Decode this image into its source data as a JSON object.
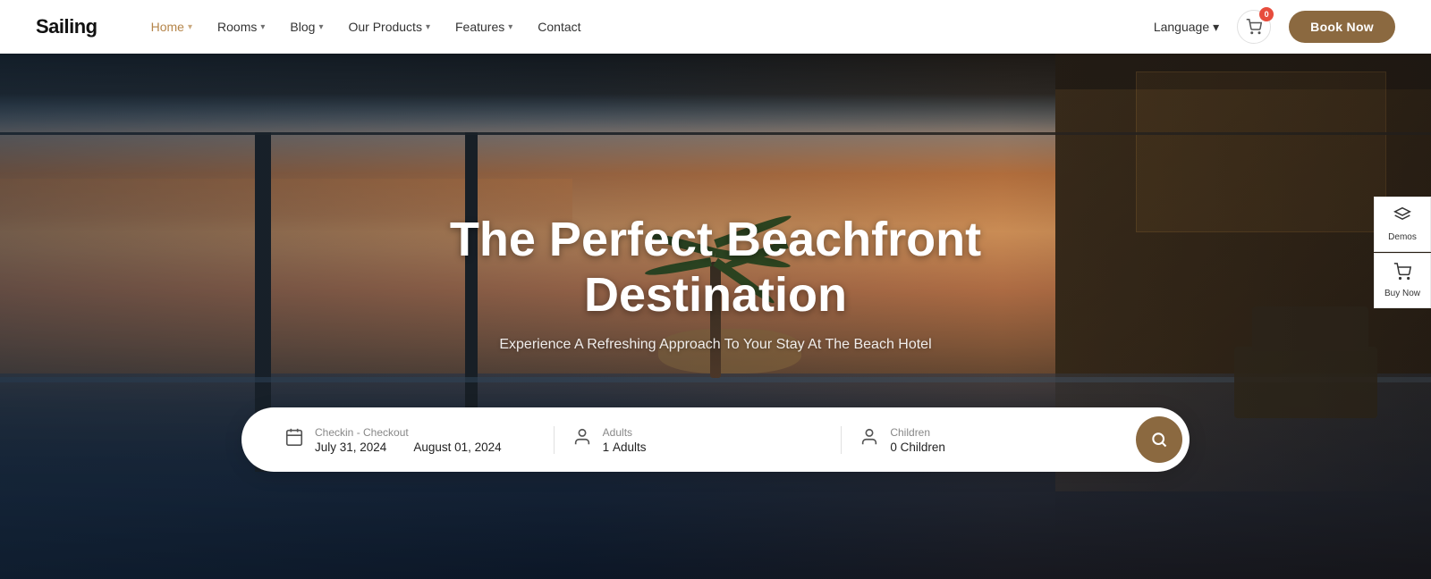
{
  "brand": {
    "logo": "Sailing"
  },
  "navbar": {
    "links": [
      {
        "label": "Home",
        "active": true,
        "hasDropdown": true
      },
      {
        "label": "Rooms",
        "active": false,
        "hasDropdown": true
      },
      {
        "label": "Blog",
        "active": false,
        "hasDropdown": true
      },
      {
        "label": "Our Products",
        "active": false,
        "hasDropdown": true
      },
      {
        "label": "Features",
        "active": false,
        "hasDropdown": true
      },
      {
        "label": "Contact",
        "active": false,
        "hasDropdown": false
      }
    ],
    "language_label": "Language",
    "cart_count": "0",
    "book_btn": "Book Now"
  },
  "hero": {
    "title": "The Perfect Beachfront Destination",
    "subtitle": "Experience A Refreshing Approach To Your Stay At The Beach Hotel"
  },
  "search": {
    "checkin_label": "Checkin - Checkout",
    "checkin_date": "July 31, 2024",
    "checkout_date": "August 01, 2024",
    "adults_label": "Adults",
    "adults_count": "1",
    "adults_placeholder": "Adults",
    "children_label": "Children",
    "children_count": "0",
    "children_placeholder": "Children"
  },
  "float_buttons": [
    {
      "label": "Demos",
      "icon": "≡"
    },
    {
      "label": "Buy Now",
      "icon": "🛒"
    }
  ],
  "colors": {
    "accent": "#8B6940",
    "active_nav": "#b5854a",
    "badge": "#e74c3c"
  }
}
